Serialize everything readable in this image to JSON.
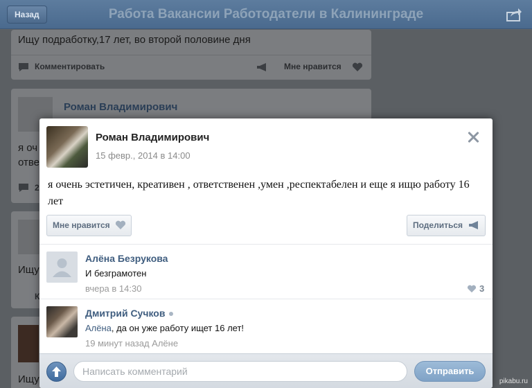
{
  "navbar": {
    "back_label": "Назад",
    "title": "Работа Вакансии Работодатели в Калининграде"
  },
  "feed": {
    "post1_text": "Ищу подработку,17 лет, во второй половине дня",
    "comment_label": "Комментировать",
    "like_label": "Мне нравится",
    "post2_author": "Роман Владимирович",
    "post2_fragment_1": "я оч",
    "post2_fragment_2": "отве",
    "post2_count": "2",
    "post3_fragment": "Ищу",
    "post3_fragment_2": "К",
    "post4_fragment": "Ищу"
  },
  "modal": {
    "author": "Роман Владимирович",
    "date": "15 февр., 2014 в 14:00",
    "post_text": "я очень эстетичен, креативен , ответственен ,умен ,респектабелен и еще я ищю работу 16 лет",
    "like_label": "Мне нравится",
    "share_label": "Поделиться"
  },
  "comments": [
    {
      "name": "Алёна Безрукова",
      "text": "И безграмотен",
      "time": "вчера в 14:30",
      "likes": "3"
    },
    {
      "name": "Дмитрий Сучков",
      "reply_to": "Алёна",
      "text": ", да он уже работу ищет 16 лет!",
      "time": "19 минут назад Алёне"
    }
  ],
  "compose": {
    "placeholder": "Написать комментарий",
    "send_label": "Отправить"
  },
  "watermark": "pikabu.ru",
  "colors": {
    "accent": "#3f5d7f",
    "navbar": "#4a6a8e",
    "send_button": "#8aaccd"
  }
}
